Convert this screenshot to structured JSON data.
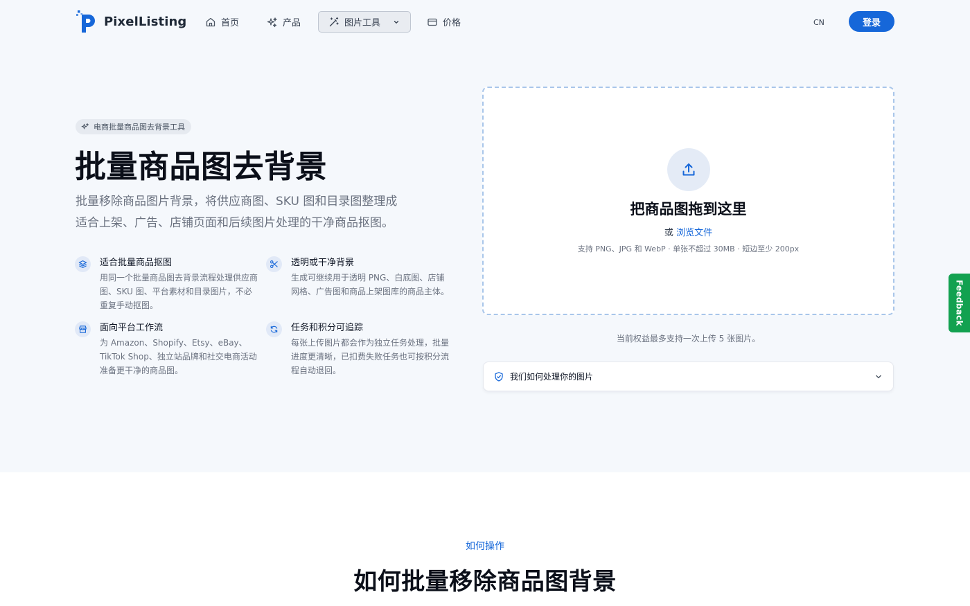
{
  "brand": {
    "name": "PixelListing",
    "accent_color": "#1667d9"
  },
  "nav": {
    "items": [
      {
        "label": "首页",
        "icon": "home-icon"
      },
      {
        "label": "产品",
        "icon": "sparkles-icon"
      },
      {
        "label": "图片工具",
        "icon": "magic-wand-icon",
        "expanded": false
      },
      {
        "label": "价格",
        "icon": "credit-card-icon"
      }
    ],
    "language": "CN",
    "login_label": "登录"
  },
  "hero": {
    "badge": "电商批量商品图去背景工具",
    "title": "批量商品图去背景",
    "description_line1": "批量移除商品图片背景，将供应商图、SKU 图和目录图整理成",
    "description_line2": "适合上架、广告、店铺页面和后续图片处理的干净商品抠图。",
    "features": [
      {
        "title": "适合批量商品抠图",
        "icon": "layers-icon",
        "description": "用同一个批量商品图去背景流程处理供应商图、SKU 图、平台素材和目录图片，不必重复手动抠图。"
      },
      {
        "title": "透明或干净背景",
        "icon": "scissors-icon",
        "description": "生成可继续用于透明 PNG、白底图、店铺网格、广告图和商品上架图库的商品主体。"
      },
      {
        "title": "面向平台工作流",
        "icon": "store-icon",
        "description": "为 Amazon、Shopify、Etsy、eBay、TikTok Shop、独立站品牌和社交电商活动准备更干净的商品图。"
      },
      {
        "title": "任务和积分可追踪",
        "icon": "refresh-icon",
        "description": "每张上传图片都会作为独立任务处理，批量进度更清晰，已扣费失败任务也可按积分流程自动退回。"
      }
    ]
  },
  "upload": {
    "title": "把商品图拖到这里",
    "or_text": "或",
    "browse_label": "浏览文件",
    "hint": "支持 PNG、JPG 和 WebP · 单张不超过 30MB · 短边至少 200px",
    "quota_text": "当前权益最多支持一次上传 5 张图片。",
    "privacy_label": "我们如何处理你的图片"
  },
  "feedback_label": "Feedback",
  "howto": {
    "label": "如何操作",
    "title": "如何批量移除商品图背景"
  }
}
